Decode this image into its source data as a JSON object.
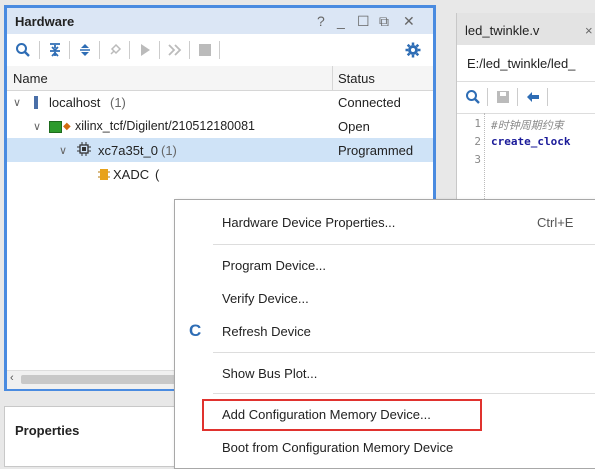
{
  "hardware": {
    "title": "Hardware",
    "win_buttons": [
      "?",
      "_",
      "☐",
      "⧉",
      "✕"
    ],
    "columns": {
      "name": "Name",
      "status": "Status"
    },
    "rows": [
      {
        "label": "localhost",
        "count": "(1)",
        "status": "Connected"
      },
      {
        "label": "xilinx_tcf/Digilent/210512180081",
        "status": "Open"
      },
      {
        "label": "xc7a35t_0",
        "count": "(1)",
        "status": "Programmed"
      },
      {
        "label": "XADC",
        "extra": "(",
        "status": ""
      }
    ]
  },
  "properties": {
    "title": "Properties"
  },
  "editor": {
    "tab_title": "led_twinkle.v",
    "tab_close": "×",
    "path": "E:/led_twinkle/led_",
    "lines": [
      {
        "n": "1",
        "text": "#时钟周期约束",
        "color": "#8a8a8a"
      },
      {
        "n": "2",
        "text": "create_clock",
        "color": "#1a1a99"
      },
      {
        "n": "3",
        "text": "",
        "color": "#000"
      }
    ]
  },
  "menu": {
    "items": [
      {
        "label": "Hardware Device Properties...",
        "shortcut": "Ctrl+E"
      },
      {
        "label": "Program Device..."
      },
      {
        "label": "Verify Device..."
      },
      {
        "label": "Refresh Device",
        "icon": "C"
      },
      {
        "label": "Show Bus Plot..."
      },
      {
        "label": "Add Configuration Memory Device..."
      },
      {
        "label": "Boot from Configuration Memory Device"
      }
    ]
  },
  "colors": {
    "accent": "#4a8be0",
    "highlight": "#e0322e",
    "selected_row": "#cfe3f7"
  }
}
